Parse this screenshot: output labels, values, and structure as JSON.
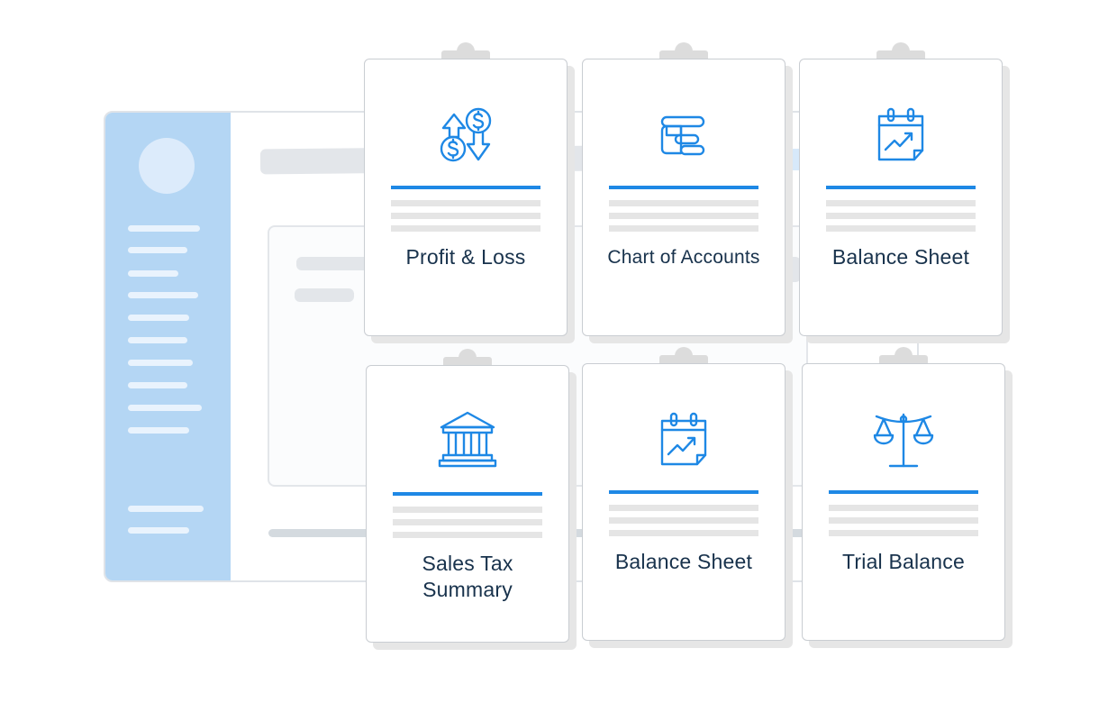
{
  "cards": [
    {
      "label": "Profit & Loss",
      "icon": "profit-loss-icon"
    },
    {
      "label": "Chart of Accounts",
      "icon": "chart-of-accounts-icon"
    },
    {
      "label": "Balance Sheet",
      "icon": "calendar-chart-icon"
    },
    {
      "label": "Sales Tax\nSummary",
      "icon": "bank-icon"
    },
    {
      "label": "Balance Sheet",
      "icon": "calendar-chart-icon"
    },
    {
      "label": "Trial Balance",
      "icon": "scales-icon"
    }
  ],
  "colors": {
    "accent": "#1e88e5",
    "text": "#18324c",
    "sidebar": "#b4d6f4",
    "skeleton": "#e3e6ea"
  }
}
